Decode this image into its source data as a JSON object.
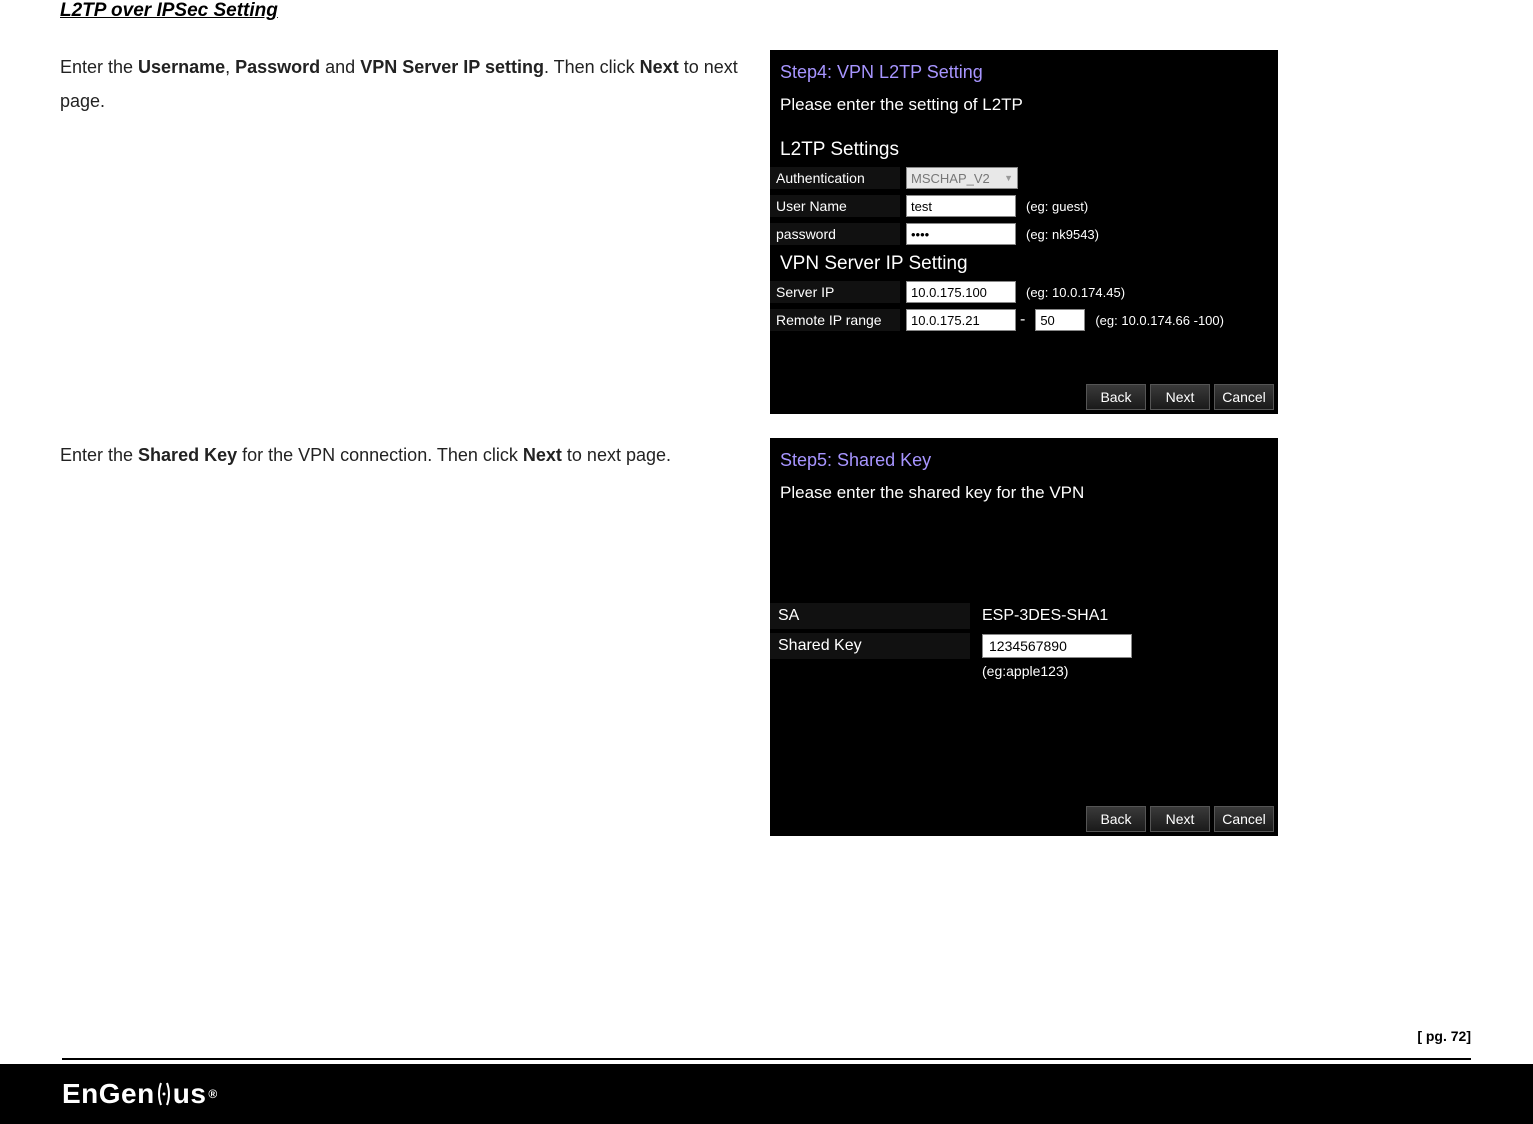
{
  "heading": "L2TP over IPSec Setting",
  "instruction1": {
    "pre1": "Enter the ",
    "b1": "Username",
    "sep1": ", ",
    "b2": "Password",
    "sep2": " and ",
    "b3": "VPN Server IP setting",
    "sep3": ". Then click ",
    "b4": "Next",
    "post": " to next page."
  },
  "panel1": {
    "step": "Step4: VPN L2TP Setting",
    "sub": "Please enter the setting of L2TP",
    "group1": "L2TP Settings",
    "auth_label": "Authentication",
    "auth_value": "MSCHAP_V2",
    "user_label": "User Name",
    "user_value": "test",
    "user_hint": "(eg: guest)",
    "pass_label": "password",
    "pass_value": "••••",
    "pass_hint": "(eg: nk9543)",
    "group2": "VPN Server IP Setting",
    "server_label": "Server IP",
    "server_value": "10.0.175.100",
    "server_hint": "(eg: 10.0.174.45)",
    "remote_label": "Remote IP range",
    "remote_value1": "10.0.175.21",
    "remote_sep": "-",
    "remote_value2": "50",
    "remote_hint": "(eg: 10.0.174.66 -100)",
    "back": "Back",
    "next": "Next",
    "cancel": "Cancel"
  },
  "instruction2": {
    "pre1": "Enter the ",
    "b1": "Shared Key",
    "mid": " for the VPN connection. Then click ",
    "b2": "Next",
    "post": " to next page."
  },
  "panel2": {
    "step": "Step5: Shared Key",
    "sub": "Please enter the shared key for the VPN",
    "sa_label": "SA",
    "sa_value": "ESP-3DES-SHA1",
    "sk_label": "Shared Key",
    "sk_value": "1234567890",
    "sk_hint": "(eg:apple123)",
    "back": "Back",
    "next": "Next",
    "cancel": "Cancel"
  },
  "footer": {
    "page": "[ pg. 72]",
    "logo_pre": "EnGen",
    "logo_post": "us",
    "reg": "®"
  }
}
